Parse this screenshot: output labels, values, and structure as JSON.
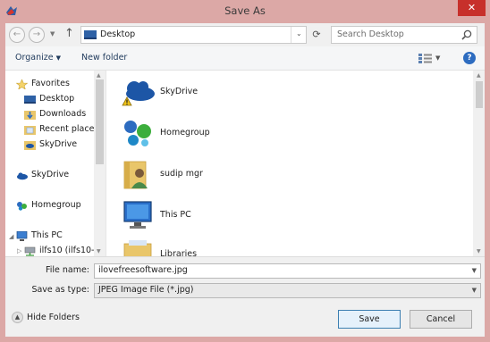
{
  "window": {
    "title": "Save As",
    "close_label": "✕"
  },
  "navigation": {
    "back_glyph": "←",
    "forward_glyph": "→",
    "up_glyph": "↑",
    "address": "Desktop",
    "search_placeholder": "Search Desktop"
  },
  "commands": {
    "organize": "Organize",
    "new_folder": "New folder",
    "help": "?"
  },
  "nav_pane": {
    "items": [
      {
        "label": "Favorites",
        "icon": "star-icon"
      },
      {
        "label": "Desktop",
        "icon": "desktop-icon"
      },
      {
        "label": "Downloads",
        "icon": "downloads-icon"
      },
      {
        "label": "Recent places",
        "icon": "recent-places-icon"
      },
      {
        "label": "SkyDrive",
        "icon": "skydrive-icon"
      },
      {
        "label": "SkyDrive",
        "icon": "skydrive-icon"
      },
      {
        "label": "Homegroup",
        "icon": "homegroup-icon"
      },
      {
        "label": "This PC",
        "icon": "computer-icon"
      },
      {
        "label": "ilfs10 (ilfs10-p",
        "icon": "network-drive-icon"
      }
    ]
  },
  "content": {
    "items": [
      {
        "label": "SkyDrive",
        "icon": "skydrive-warning-icon"
      },
      {
        "label": "Homegroup",
        "icon": "homegroup-icon"
      },
      {
        "label": "sudip mgr",
        "icon": "user-folder-icon"
      },
      {
        "label": "This PC",
        "icon": "computer-icon"
      },
      {
        "label": "Libraries",
        "icon": "libraries-icon"
      }
    ]
  },
  "fields": {
    "file_name_label": "File name:",
    "file_name_value": "ilovefreesoftware.jpg",
    "save_type_label": "Save as type:",
    "save_type_value": "JPEG Image File (*.jpg)"
  },
  "footer": {
    "hide_folders": "Hide Folders",
    "save": "Save",
    "cancel": "Cancel"
  },
  "colors": {
    "titlebar": "#dca8a6",
    "close_button": "#c7302b",
    "accent_blue": "#2d6cc0"
  }
}
